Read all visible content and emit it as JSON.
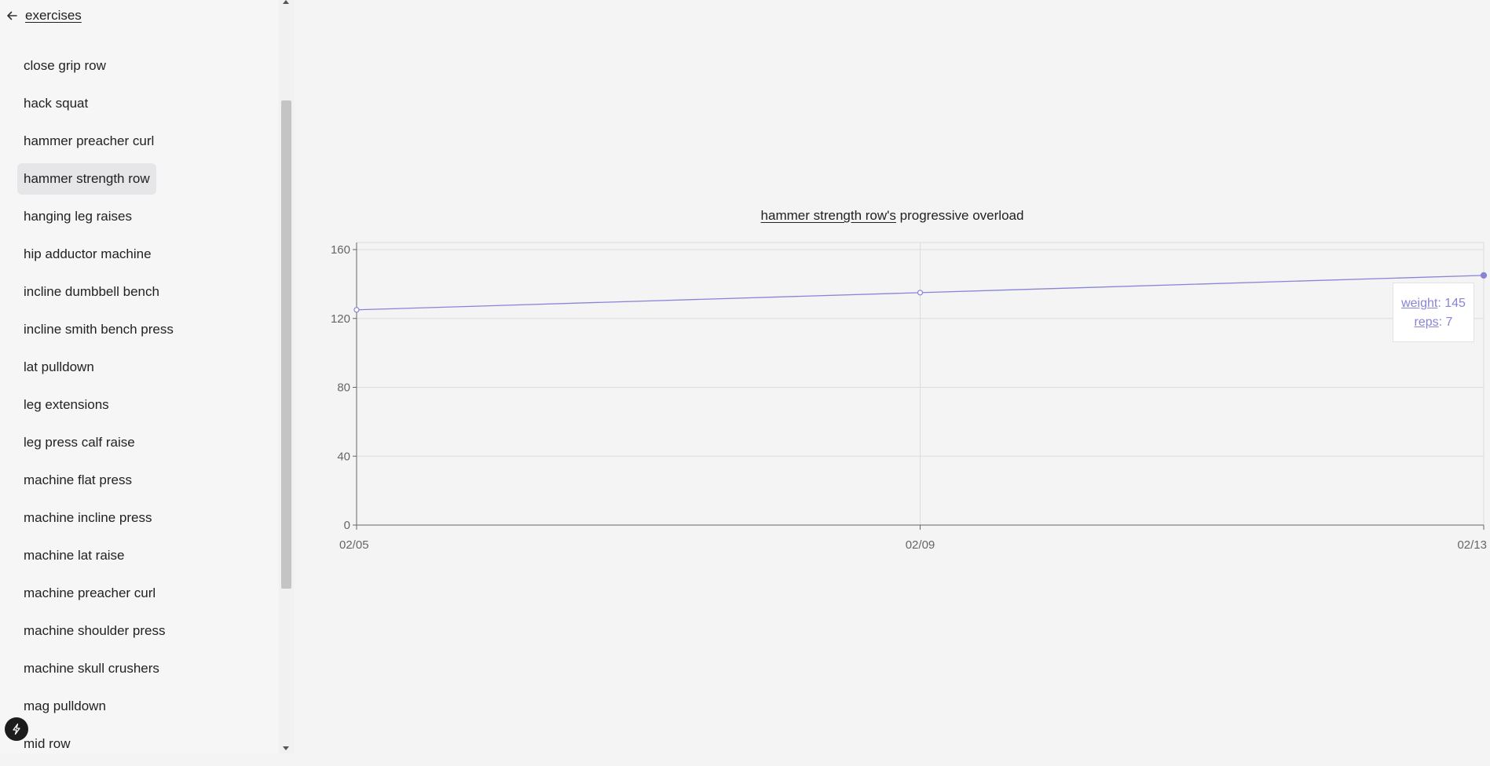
{
  "sidebar": {
    "back_label": "exercises",
    "items": [
      {
        "label": "close grip row"
      },
      {
        "label": "hack squat"
      },
      {
        "label": "hammer preacher curl"
      },
      {
        "label": "hammer strength row",
        "selected": true
      },
      {
        "label": "hanging leg raises"
      },
      {
        "label": "hip adductor machine"
      },
      {
        "label": "incline dumbbell bench"
      },
      {
        "label": "incline smith bench press"
      },
      {
        "label": "lat pulldown"
      },
      {
        "label": "leg extensions"
      },
      {
        "label": "leg press calf raise"
      },
      {
        "label": "machine flat press"
      },
      {
        "label": "machine incline press"
      },
      {
        "label": "machine lat raise"
      },
      {
        "label": "machine preacher curl"
      },
      {
        "label": "machine shoulder press"
      },
      {
        "label": "machine skull crushers"
      },
      {
        "label": "mag pulldown"
      },
      {
        "label": "mid row"
      }
    ]
  },
  "chart": {
    "exercise_name": "hammer strength row's",
    "title_suffix": " progressive overload",
    "line_color": "#8884d8",
    "tooltip": {
      "weight_key": "weight",
      "weight_value": ": 145",
      "reps_key": "reps",
      "reps_value": ": 7"
    }
  },
  "chart_data": {
    "type": "line",
    "x": [
      "02/05",
      "02/09",
      "02/13"
    ],
    "series": [
      {
        "values": [
          125,
          135,
          145
        ]
      }
    ],
    "yticks": [
      0,
      40,
      80,
      120,
      160
    ],
    "ylim": [
      0,
      160
    ],
    "grid": true,
    "active_point": "02/13"
  },
  "icons": {
    "back": "arrow-left-icon",
    "badge": "lightning-bolt-icon"
  }
}
